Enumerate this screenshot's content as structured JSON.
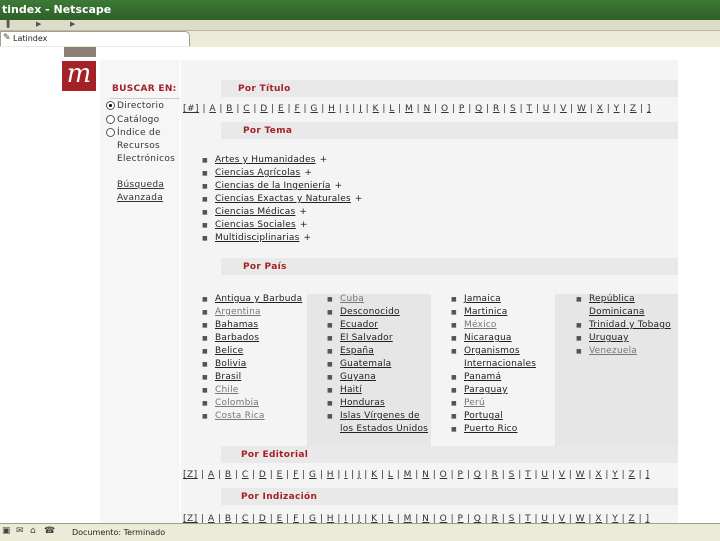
{
  "window": {
    "title": "tindex - Netscape"
  },
  "tab": {
    "label": "Latindex"
  },
  "logo": {
    "letter": "m"
  },
  "sidebar": {
    "title": "BUSCAR EN:",
    "options": [
      {
        "label": "Directorio",
        "selected": true
      },
      {
        "label": "Catálogo",
        "selected": false
      },
      {
        "label": "Índice de",
        "selected": false
      }
    ],
    "option3_line2": "Recursos",
    "option3_line3": "Electrónicos",
    "advanced_line1": "Búsqueda",
    "advanced_line2": "Avanzada"
  },
  "sections": {
    "por_titulo": "Por Título",
    "por_tema": "Por Tema",
    "por_pais": "Por País",
    "por_editorial": "Por Editorial",
    "por_indizacion": "Por Indización"
  },
  "alphabet": [
    "[#]",
    "A",
    "B",
    "C",
    "D",
    "E",
    "F",
    "G",
    "H",
    "I",
    "J",
    "K",
    "L",
    "M",
    "N",
    "O",
    "P",
    "Q",
    "R",
    "S",
    "T",
    "U",
    "V",
    "W",
    "X",
    "Y",
    "Z",
    "]"
  ],
  "alphabet2": [
    "[Z]",
    "A",
    "B",
    "C",
    "D",
    "E",
    "F",
    "G",
    "H",
    "I",
    "J",
    "K",
    "L",
    "M",
    "N",
    "O",
    "P",
    "Q",
    "R",
    "S",
    "T",
    "U",
    "V",
    "W",
    "X",
    "Y",
    "Z",
    "]"
  ],
  "topics": [
    "Artes y Humanidades",
    "Ciencias Agrícolas",
    "Ciencias de la Ingeniería",
    "Ciencias Exactas y Naturales",
    "Ciencias Médicas",
    "Ciencias Sociales",
    "Multidisciplinarias"
  ],
  "topic_plus": "+",
  "countries": {
    "col1": [
      "Antigua y Barbuda",
      "Argentina",
      "Bahamas",
      "Barbados",
      "Belice",
      "Bolivia",
      "Brasil",
      "Chile",
      "Colombia",
      "Costa Rica"
    ],
    "col2": [
      "Cuba",
      "Desconocido",
      "Ecuador",
      "El Salvador",
      "España",
      "Guatemala",
      "Guyana",
      "Haití",
      "Honduras",
      "Islas Vírgenes de",
      "los Estados Unidos"
    ],
    "col3": [
      "Jamaica",
      "Martinica",
      "México",
      "Nicaragua",
      "Organismos",
      "Internacionales",
      "Panamá",
      "Paraguay",
      "Perú",
      "Portugal",
      "Puerto Rico"
    ],
    "col4": [
      "República",
      "Dominicana",
      "Trinidad y Tobago",
      "Uruguay",
      "Venezuela"
    ]
  },
  "status": {
    "text": "Documento: Terminado"
  },
  "colors": {
    "accent": "#a52128",
    "titlebar": "#2e5f29"
  }
}
